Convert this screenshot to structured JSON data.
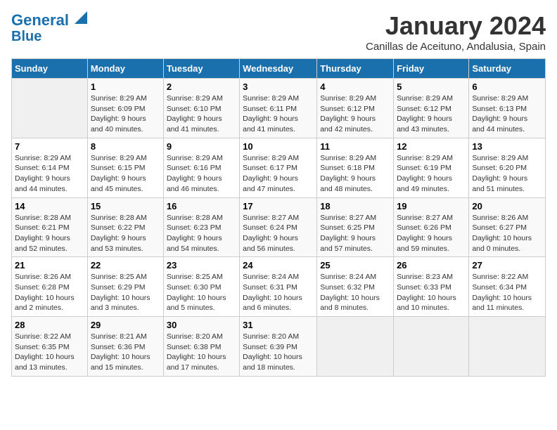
{
  "header": {
    "logo_line1": "General",
    "logo_line2": "Blue",
    "month_title": "January 2024",
    "subtitle": "Canillas de Aceituno, Andalusia, Spain"
  },
  "days_of_week": [
    "Sunday",
    "Monday",
    "Tuesday",
    "Wednesday",
    "Thursday",
    "Friday",
    "Saturday"
  ],
  "weeks": [
    [
      {
        "num": "",
        "info": ""
      },
      {
        "num": "1",
        "info": "Sunrise: 8:29 AM\nSunset: 6:09 PM\nDaylight: 9 hours\nand 40 minutes."
      },
      {
        "num": "2",
        "info": "Sunrise: 8:29 AM\nSunset: 6:10 PM\nDaylight: 9 hours\nand 41 minutes."
      },
      {
        "num": "3",
        "info": "Sunrise: 8:29 AM\nSunset: 6:11 PM\nDaylight: 9 hours\nand 41 minutes."
      },
      {
        "num": "4",
        "info": "Sunrise: 8:29 AM\nSunset: 6:12 PM\nDaylight: 9 hours\nand 42 minutes."
      },
      {
        "num": "5",
        "info": "Sunrise: 8:29 AM\nSunset: 6:12 PM\nDaylight: 9 hours\nand 43 minutes."
      },
      {
        "num": "6",
        "info": "Sunrise: 8:29 AM\nSunset: 6:13 PM\nDaylight: 9 hours\nand 44 minutes."
      }
    ],
    [
      {
        "num": "7",
        "info": "Sunrise: 8:29 AM\nSunset: 6:14 PM\nDaylight: 9 hours\nand 44 minutes."
      },
      {
        "num": "8",
        "info": "Sunrise: 8:29 AM\nSunset: 6:15 PM\nDaylight: 9 hours\nand 45 minutes."
      },
      {
        "num": "9",
        "info": "Sunrise: 8:29 AM\nSunset: 6:16 PM\nDaylight: 9 hours\nand 46 minutes."
      },
      {
        "num": "10",
        "info": "Sunrise: 8:29 AM\nSunset: 6:17 PM\nDaylight: 9 hours\nand 47 minutes."
      },
      {
        "num": "11",
        "info": "Sunrise: 8:29 AM\nSunset: 6:18 PM\nDaylight: 9 hours\nand 48 minutes."
      },
      {
        "num": "12",
        "info": "Sunrise: 8:29 AM\nSunset: 6:19 PM\nDaylight: 9 hours\nand 49 minutes."
      },
      {
        "num": "13",
        "info": "Sunrise: 8:29 AM\nSunset: 6:20 PM\nDaylight: 9 hours\nand 51 minutes."
      }
    ],
    [
      {
        "num": "14",
        "info": "Sunrise: 8:28 AM\nSunset: 6:21 PM\nDaylight: 9 hours\nand 52 minutes."
      },
      {
        "num": "15",
        "info": "Sunrise: 8:28 AM\nSunset: 6:22 PM\nDaylight: 9 hours\nand 53 minutes."
      },
      {
        "num": "16",
        "info": "Sunrise: 8:28 AM\nSunset: 6:23 PM\nDaylight: 9 hours\nand 54 minutes."
      },
      {
        "num": "17",
        "info": "Sunrise: 8:27 AM\nSunset: 6:24 PM\nDaylight: 9 hours\nand 56 minutes."
      },
      {
        "num": "18",
        "info": "Sunrise: 8:27 AM\nSunset: 6:25 PM\nDaylight: 9 hours\nand 57 minutes."
      },
      {
        "num": "19",
        "info": "Sunrise: 8:27 AM\nSunset: 6:26 PM\nDaylight: 9 hours\nand 59 minutes."
      },
      {
        "num": "20",
        "info": "Sunrise: 8:26 AM\nSunset: 6:27 PM\nDaylight: 10 hours\nand 0 minutes."
      }
    ],
    [
      {
        "num": "21",
        "info": "Sunrise: 8:26 AM\nSunset: 6:28 PM\nDaylight: 10 hours\nand 2 minutes."
      },
      {
        "num": "22",
        "info": "Sunrise: 8:25 AM\nSunset: 6:29 PM\nDaylight: 10 hours\nand 3 minutes."
      },
      {
        "num": "23",
        "info": "Sunrise: 8:25 AM\nSunset: 6:30 PM\nDaylight: 10 hours\nand 5 minutes."
      },
      {
        "num": "24",
        "info": "Sunrise: 8:24 AM\nSunset: 6:31 PM\nDaylight: 10 hours\nand 6 minutes."
      },
      {
        "num": "25",
        "info": "Sunrise: 8:24 AM\nSunset: 6:32 PM\nDaylight: 10 hours\nand 8 minutes."
      },
      {
        "num": "26",
        "info": "Sunrise: 8:23 AM\nSunset: 6:33 PM\nDaylight: 10 hours\nand 10 minutes."
      },
      {
        "num": "27",
        "info": "Sunrise: 8:22 AM\nSunset: 6:34 PM\nDaylight: 10 hours\nand 11 minutes."
      }
    ],
    [
      {
        "num": "28",
        "info": "Sunrise: 8:22 AM\nSunset: 6:35 PM\nDaylight: 10 hours\nand 13 minutes."
      },
      {
        "num": "29",
        "info": "Sunrise: 8:21 AM\nSunset: 6:36 PM\nDaylight: 10 hours\nand 15 minutes."
      },
      {
        "num": "30",
        "info": "Sunrise: 8:20 AM\nSunset: 6:38 PM\nDaylight: 10 hours\nand 17 minutes."
      },
      {
        "num": "31",
        "info": "Sunrise: 8:20 AM\nSunset: 6:39 PM\nDaylight: 10 hours\nand 18 minutes."
      },
      {
        "num": "",
        "info": ""
      },
      {
        "num": "",
        "info": ""
      },
      {
        "num": "",
        "info": ""
      }
    ]
  ]
}
